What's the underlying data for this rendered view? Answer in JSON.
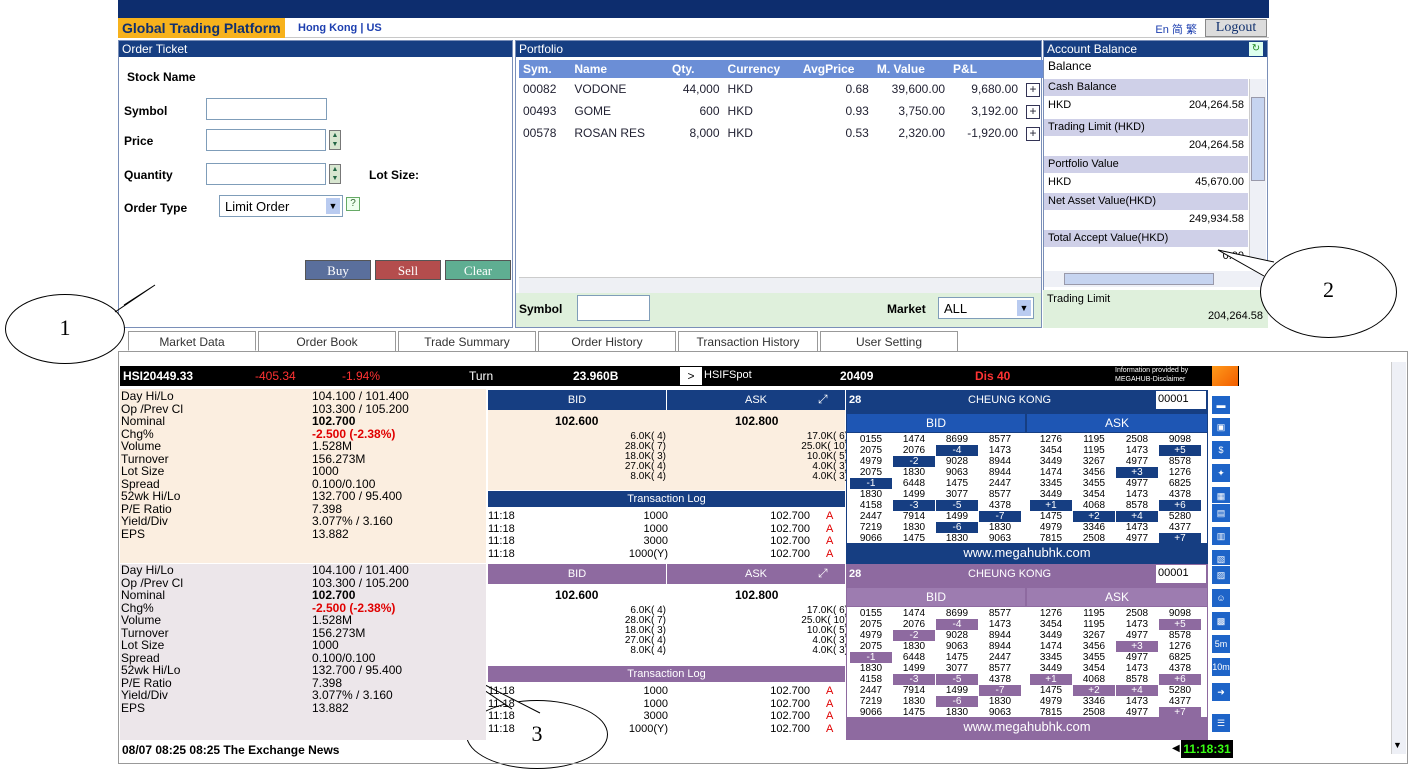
{
  "header": {
    "brand": "Global Trading Platform",
    "regions": "Hong Kong | US",
    "langs": "En 简 繁",
    "logout": "Logout"
  },
  "order_ticket": {
    "title": "Order Ticket",
    "stock_name_label": "Stock Name",
    "symbol_label": "Symbol",
    "price_label": "Price",
    "quantity_label": "Quantity",
    "lot_size_label": "Lot Size:",
    "order_type_label": "Order Type",
    "order_type_value": "Limit Order",
    "help": "?",
    "buy": "Buy",
    "sell": "Sell",
    "clear": "Clear"
  },
  "portfolio": {
    "title": "Portfolio",
    "columns": [
      "Sym.",
      "Name",
      "Qty.",
      "Currency",
      "AvgPrice",
      "M. Value",
      "P&L"
    ],
    "rows": [
      [
        "00082",
        "VODONE",
        "44,000",
        "HKD",
        "0.68",
        "39,600.00",
        "9,680.00"
      ],
      [
        "00493",
        "GOME",
        "600",
        "HKD",
        "0.93",
        "3,750.00",
        "3,192.00"
      ],
      [
        "00578",
        "ROSAN RES",
        "8,000",
        "HKD",
        "0.53",
        "2,320.00",
        "-1,920.00"
      ]
    ],
    "symbol_label": "Symbol",
    "market_label": "Market",
    "market_value": "ALL"
  },
  "account": {
    "title": "Account Balance",
    "balance": "Balance",
    "cash_balance": "Cash Balance",
    "cash_ccy": "HKD",
    "cash_value": "204,264.58",
    "trading_limit_hkd": "Trading Limit (HKD)",
    "trading_limit_value": "204,264.58",
    "portfolio_value": "Portfolio Value",
    "pv_ccy": "HKD",
    "pv_value": "45,670.00",
    "nav": "Net Asset Value(HKD)",
    "nav_value": "249,934.58",
    "tav": "Total Accept Value(HKD)",
    "tav_value": "0.00",
    "trading_limit": "Trading Limit",
    "trading_limit_value2": "204,264.58"
  },
  "callouts": [
    "1",
    "2",
    "3"
  ],
  "tabs": [
    "Market Data",
    "Order Book",
    "Trade Summary",
    "Order History",
    "Transaction History",
    "User Setting"
  ],
  "ticker": {
    "hsi": "HSI20449.33",
    "chg": "-405.34",
    "pct": "-1.94%",
    "turn_label": "Turn",
    "turn": "23.960B",
    "hsif_btn": ">",
    "hsif": "HSIFSpot",
    "hsif_val": "20409",
    "dis": "Dis 40",
    "info": "Information provided by MEGAHUB-Disclaimer"
  },
  "quote": {
    "labels": [
      "Day Hi/Lo",
      "Op /Prev Cl",
      "Nominal",
      "Chg%",
      "Volume",
      "Turnover",
      "Lot Size",
      "Spread",
      "52wk Hi/Lo",
      "P/E Ratio",
      "Yield/Div",
      "EPS"
    ],
    "values": [
      "104.100 / 101.400",
      "103.300 / 105.200",
      "102.700",
      "-2.500 (-2.38%)",
      "1.528M",
      "156.273M",
      "1000",
      "0.100/0.100",
      "132.700 / 95.400",
      "7.398",
      "3.077% / 3.160",
      "13.882"
    ]
  },
  "depth": {
    "bid": "BID",
    "ask": "ASK",
    "bid_price": "102.600",
    "ask_price": "102.800",
    "bid_q": [
      "6.0K( 4)",
      "28.0K( 7)",
      "18.0K( 3)",
      "27.0K( 4)",
      "8.0K( 4)"
    ],
    "ask_q": [
      "17.0K( 6)",
      "25.0K( 10)",
      "10.0K( 5)",
      "4.0K( 3)",
      "4.0K( 3)"
    ],
    "tlog": "Transaction Log",
    "trades": [
      [
        "11:18",
        "1000",
        "102.700",
        "A"
      ],
      [
        "11:18",
        "1000",
        "102.700",
        "A"
      ],
      [
        "11:18",
        "3000",
        "102.700",
        "A"
      ],
      [
        "11:18",
        "1000(Y)",
        "102.700",
        "A"
      ]
    ]
  },
  "broker": {
    "num": "28",
    "name": "CHEUNG KONG",
    "code": "00001",
    "bid": "BID",
    "ask": "ASK",
    "url": "www.megahubhk.com",
    "bid_rows": [
      [
        "0155",
        "1474",
        "8699",
        "8577"
      ],
      [
        "2075",
        "2076",
        "-4",
        "1473"
      ],
      [
        "4979",
        "-2",
        "9028",
        "8944"
      ],
      [
        "2075",
        "1830",
        "9063",
        "8944"
      ],
      [
        "-1",
        "6448",
        "1475",
        "2447"
      ],
      [
        "1830",
        "1499",
        "3077",
        "8577"
      ],
      [
        "4158",
        "-3",
        "-5",
        "4378"
      ],
      [
        "2447",
        "7914",
        "1499",
        "-7"
      ],
      [
        "7219",
        "1830",
        "-6",
        "1830"
      ],
      [
        "9066",
        "1475",
        "1830",
        "9063"
      ]
    ],
    "ask_rows": [
      [
        "1276",
        "1195",
        "2508",
        "9098"
      ],
      [
        "3454",
        "1195",
        "1473",
        "+5"
      ],
      [
        "3449",
        "3267",
        "4977",
        "8578"
      ],
      [
        "1474",
        "3456",
        "+3",
        "1276"
      ],
      [
        "3345",
        "3455",
        "4977",
        "6825"
      ],
      [
        "3449",
        "3454",
        "1473",
        "4378"
      ],
      [
        "+1",
        "4068",
        "8578",
        "+6"
      ],
      [
        "1475",
        "+2",
        "+4",
        "5280"
      ],
      [
        "4979",
        "3346",
        "1473",
        "4377"
      ],
      [
        "7815",
        "2508",
        "4977",
        "+7"
      ]
    ]
  },
  "news": "08/07 08:25 08:25 The Exchange News",
  "clock": "11:18:31",
  "colors": {
    "navy": "#163e82",
    "orange": "#f7b21c",
    "purple": "#8e6aa0",
    "red": "#e00000"
  }
}
